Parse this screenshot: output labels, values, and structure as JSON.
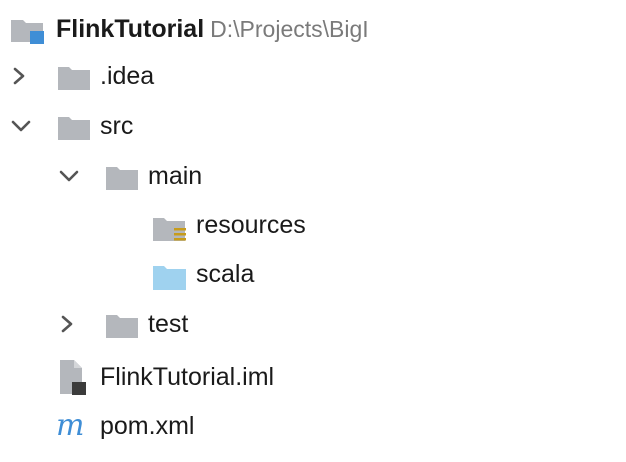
{
  "project_tree": {
    "root": {
      "name": "FlinkTutorial",
      "path": "D:\\Projects\\BigI",
      "icon": "project-folder-icon"
    },
    "items": [
      {
        "label": ".idea",
        "expanded": false,
        "icon": "folder-icon"
      },
      {
        "label": "src",
        "expanded": true,
        "icon": "folder-icon"
      },
      {
        "label": "main",
        "expanded": true,
        "icon": "folder-icon"
      },
      {
        "label": "resources",
        "icon": "resources-folder-icon"
      },
      {
        "label": "scala",
        "icon": "source-folder-icon"
      },
      {
        "label": "test",
        "expanded": false,
        "icon": "folder-icon"
      },
      {
        "label": "FlinkTutorial.iml",
        "icon": "module-file-icon"
      },
      {
        "label": "pom.xml",
        "icon": "maven-icon",
        "icon_glyph": "m"
      }
    ]
  },
  "colors": {
    "folder_gray": "#b4b7bc",
    "folder_gray_dark": "#a3a6ab",
    "source_blue": "#9fd2ef",
    "project_blue": "#3f8ed6",
    "resources_stripe": "#c79c1c",
    "chevron": "#555555",
    "maven_blue": "#3f8ed6"
  }
}
